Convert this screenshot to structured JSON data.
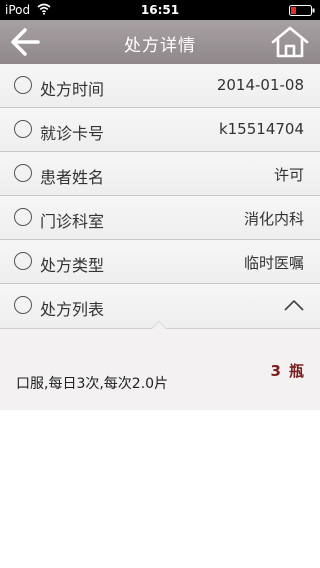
{
  "status_bar": {
    "carrier": "iPod",
    "time": "16:51"
  },
  "nav": {
    "title": "处方详情",
    "back_icon": "back-arrow-icon",
    "home_icon": "home-icon"
  },
  "rows": [
    {
      "label": "处方时间",
      "value": "2014-01-08"
    },
    {
      "label": "就诊卡号",
      "value": "k15514704"
    },
    {
      "label": "患者姓名",
      "value": "许可"
    },
    {
      "label": "门诊科室",
      "value": "消化内科"
    },
    {
      "label": "处方类型",
      "value": "临时医嘱"
    }
  ],
  "prescription_list": {
    "label": "处方列表",
    "expanded": true,
    "items": [
      {
        "dosage": "口服,每日3次,每次2.0片",
        "quantity": "3",
        "unit": "瓶"
      }
    ]
  },
  "colors": {
    "nav_bar": "#9a9395",
    "quantity": "#7a1f1f",
    "row_background": "#f2f1f2"
  }
}
